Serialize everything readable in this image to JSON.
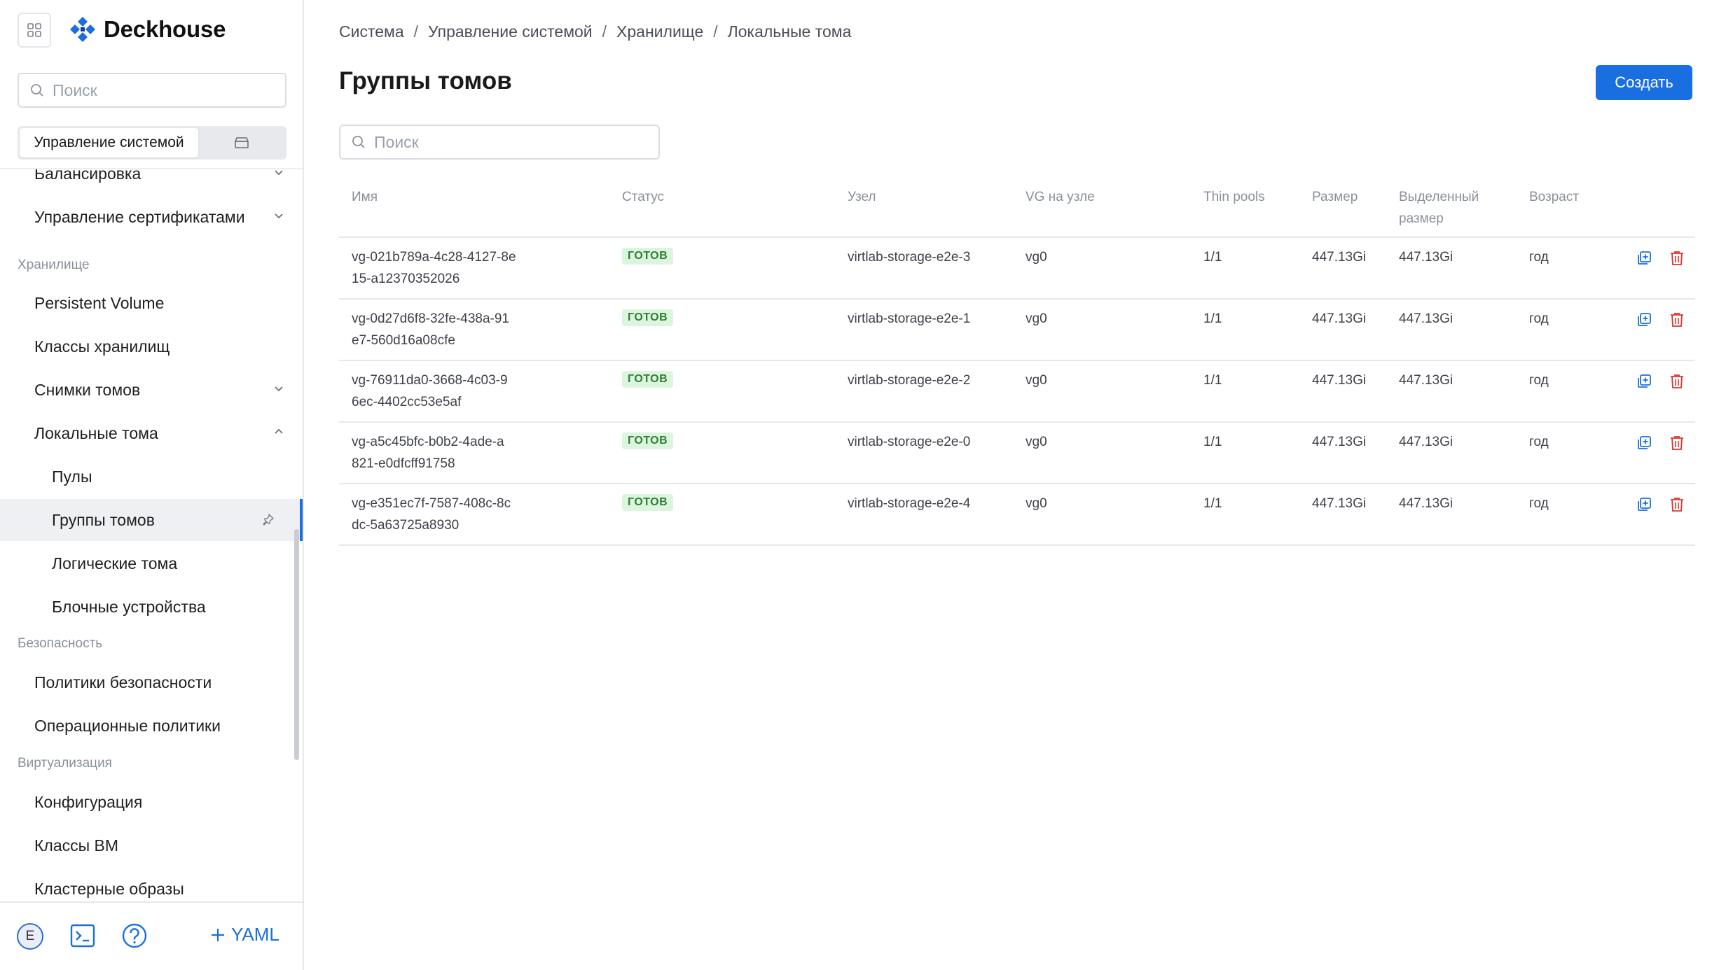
{
  "app": {
    "name": "Deckhouse"
  },
  "sidebar": {
    "search_placeholder": "Поиск",
    "segment_active": "Управление системой",
    "items": [
      {
        "label": "Балансировка",
        "chevron": "down"
      },
      {
        "label": "Управление сертификатами",
        "chevron": "down"
      },
      {
        "section": "Хранилище"
      },
      {
        "label": "Persistent Volume"
      },
      {
        "label": "Классы хранилищ"
      },
      {
        "label": "Снимки томов",
        "chevron": "down"
      },
      {
        "label": "Локальные тома",
        "chevron": "up"
      },
      {
        "label": "Пулы"
      },
      {
        "label": "Группы томов",
        "active": true
      },
      {
        "label": "Логические тома"
      },
      {
        "label": "Блочные устройства"
      },
      {
        "section": "Безопасность"
      },
      {
        "label": "Политики безопасности"
      },
      {
        "label": "Операционные политики"
      },
      {
        "section": "Виртуализация"
      },
      {
        "label": "Конфигурация"
      },
      {
        "label": "Классы ВМ"
      },
      {
        "label": "Кластерные образы"
      }
    ],
    "avatar_letter": "E",
    "yaml_label": "YAML"
  },
  "breadcrumb": [
    "Система",
    "Управление системой",
    "Хранилище",
    "Локальные тома"
  ],
  "page": {
    "title": "Группы томов",
    "create_label": "Создать",
    "search_placeholder": "Поиск"
  },
  "table": {
    "columns": [
      "Имя",
      "Статус",
      "Узел",
      "VG на узле",
      "Thin pools",
      "Размер",
      "Выделенный размер",
      "Возраст"
    ],
    "rows": [
      {
        "name_1": "vg-021b789a-4c28-4127-8e",
        "name_2": "15-a12370352026",
        "status": "ГОТОВ",
        "node": "virtlab-storage-e2e-3",
        "vg": "vg0",
        "thin": "1/1",
        "size": "447.13Gi",
        "alloc": "447.13Gi",
        "age": "год"
      },
      {
        "name_1": "vg-0d27d6f8-32fe-438a-91",
        "name_2": "e7-560d16a08cfe",
        "status": "ГОТОВ",
        "node": "virtlab-storage-e2e-1",
        "vg": "vg0",
        "thin": "1/1",
        "size": "447.13Gi",
        "alloc": "447.13Gi",
        "age": "год"
      },
      {
        "name_1": "vg-76911da0-3668-4c03-9",
        "name_2": "6ec-4402cc53e5af",
        "status": "ГОТОВ",
        "node": "virtlab-storage-e2e-2",
        "vg": "vg0",
        "thin": "1/1",
        "size": "447.13Gi",
        "alloc": "447.13Gi",
        "age": "год"
      },
      {
        "name_1": "vg-a5c45bfc-b0b2-4ade-a",
        "name_2": "821-e0dfcff91758",
        "status": "ГОТОВ",
        "node": "virtlab-storage-e2e-0",
        "vg": "vg0",
        "thin": "1/1",
        "size": "447.13Gi",
        "alloc": "447.13Gi",
        "age": "год"
      },
      {
        "name_1": "vg-e351ec7f-7587-408c-8c",
        "name_2": "dc-5a63725a8930",
        "status": "ГОТОВ",
        "node": "virtlab-storage-e2e-4",
        "vg": "vg0",
        "thin": "1/1",
        "size": "447.13Gi",
        "alloc": "447.13Gi",
        "age": "год"
      }
    ]
  },
  "colors": {
    "accent": "#1a6fe0",
    "ready_bg": "#dcf5de",
    "ready_fg": "#2f7d32",
    "delete": "#e0342c"
  }
}
